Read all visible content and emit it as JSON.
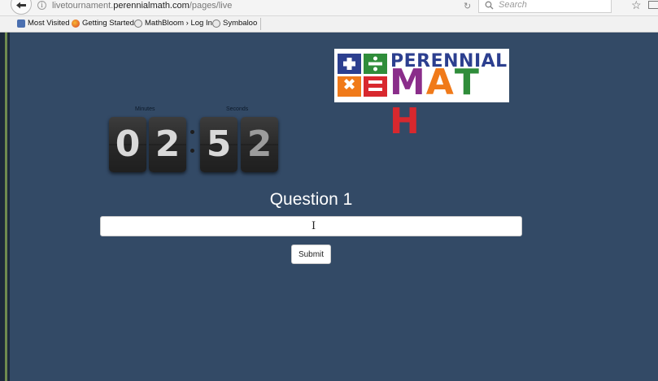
{
  "browser": {
    "url_prefix": "livetournament.",
    "url_host": "perennialmath.com",
    "url_path": "/pages/live",
    "search_placeholder": "Search",
    "bookmarks": [
      {
        "label": "Most Visited",
        "icon": "bookmark-page-icon"
      },
      {
        "label": "Getting Started",
        "icon": "firefox-icon"
      },
      {
        "label": "MathBloom › Log In",
        "icon": "globe-icon"
      },
      {
        "label": "Symbaloo",
        "icon": "globe-icon"
      }
    ]
  },
  "logo": {
    "line1": "PERENNIAL",
    "line2_letters": [
      "M",
      "A",
      "T",
      "H"
    ],
    "line2_colors": [
      "#8a2d8a",
      "#f07a1a",
      "#2f8d3a",
      "#d8282e"
    ],
    "symbol_colors": [
      "#2c3f8f",
      "#2f8d3a",
      "#f07a1a",
      "#d8282e"
    ]
  },
  "timer": {
    "minutes_label": "Minutes",
    "seconds_label": "Seconds",
    "digits": [
      "0",
      "2",
      "5",
      "2"
    ]
  },
  "question": {
    "title": "Question 1",
    "answer_value": ""
  },
  "submit_label": "Submit",
  "colors": {
    "page_background": "#334a66",
    "chrome_background": "#f1f1f1"
  }
}
